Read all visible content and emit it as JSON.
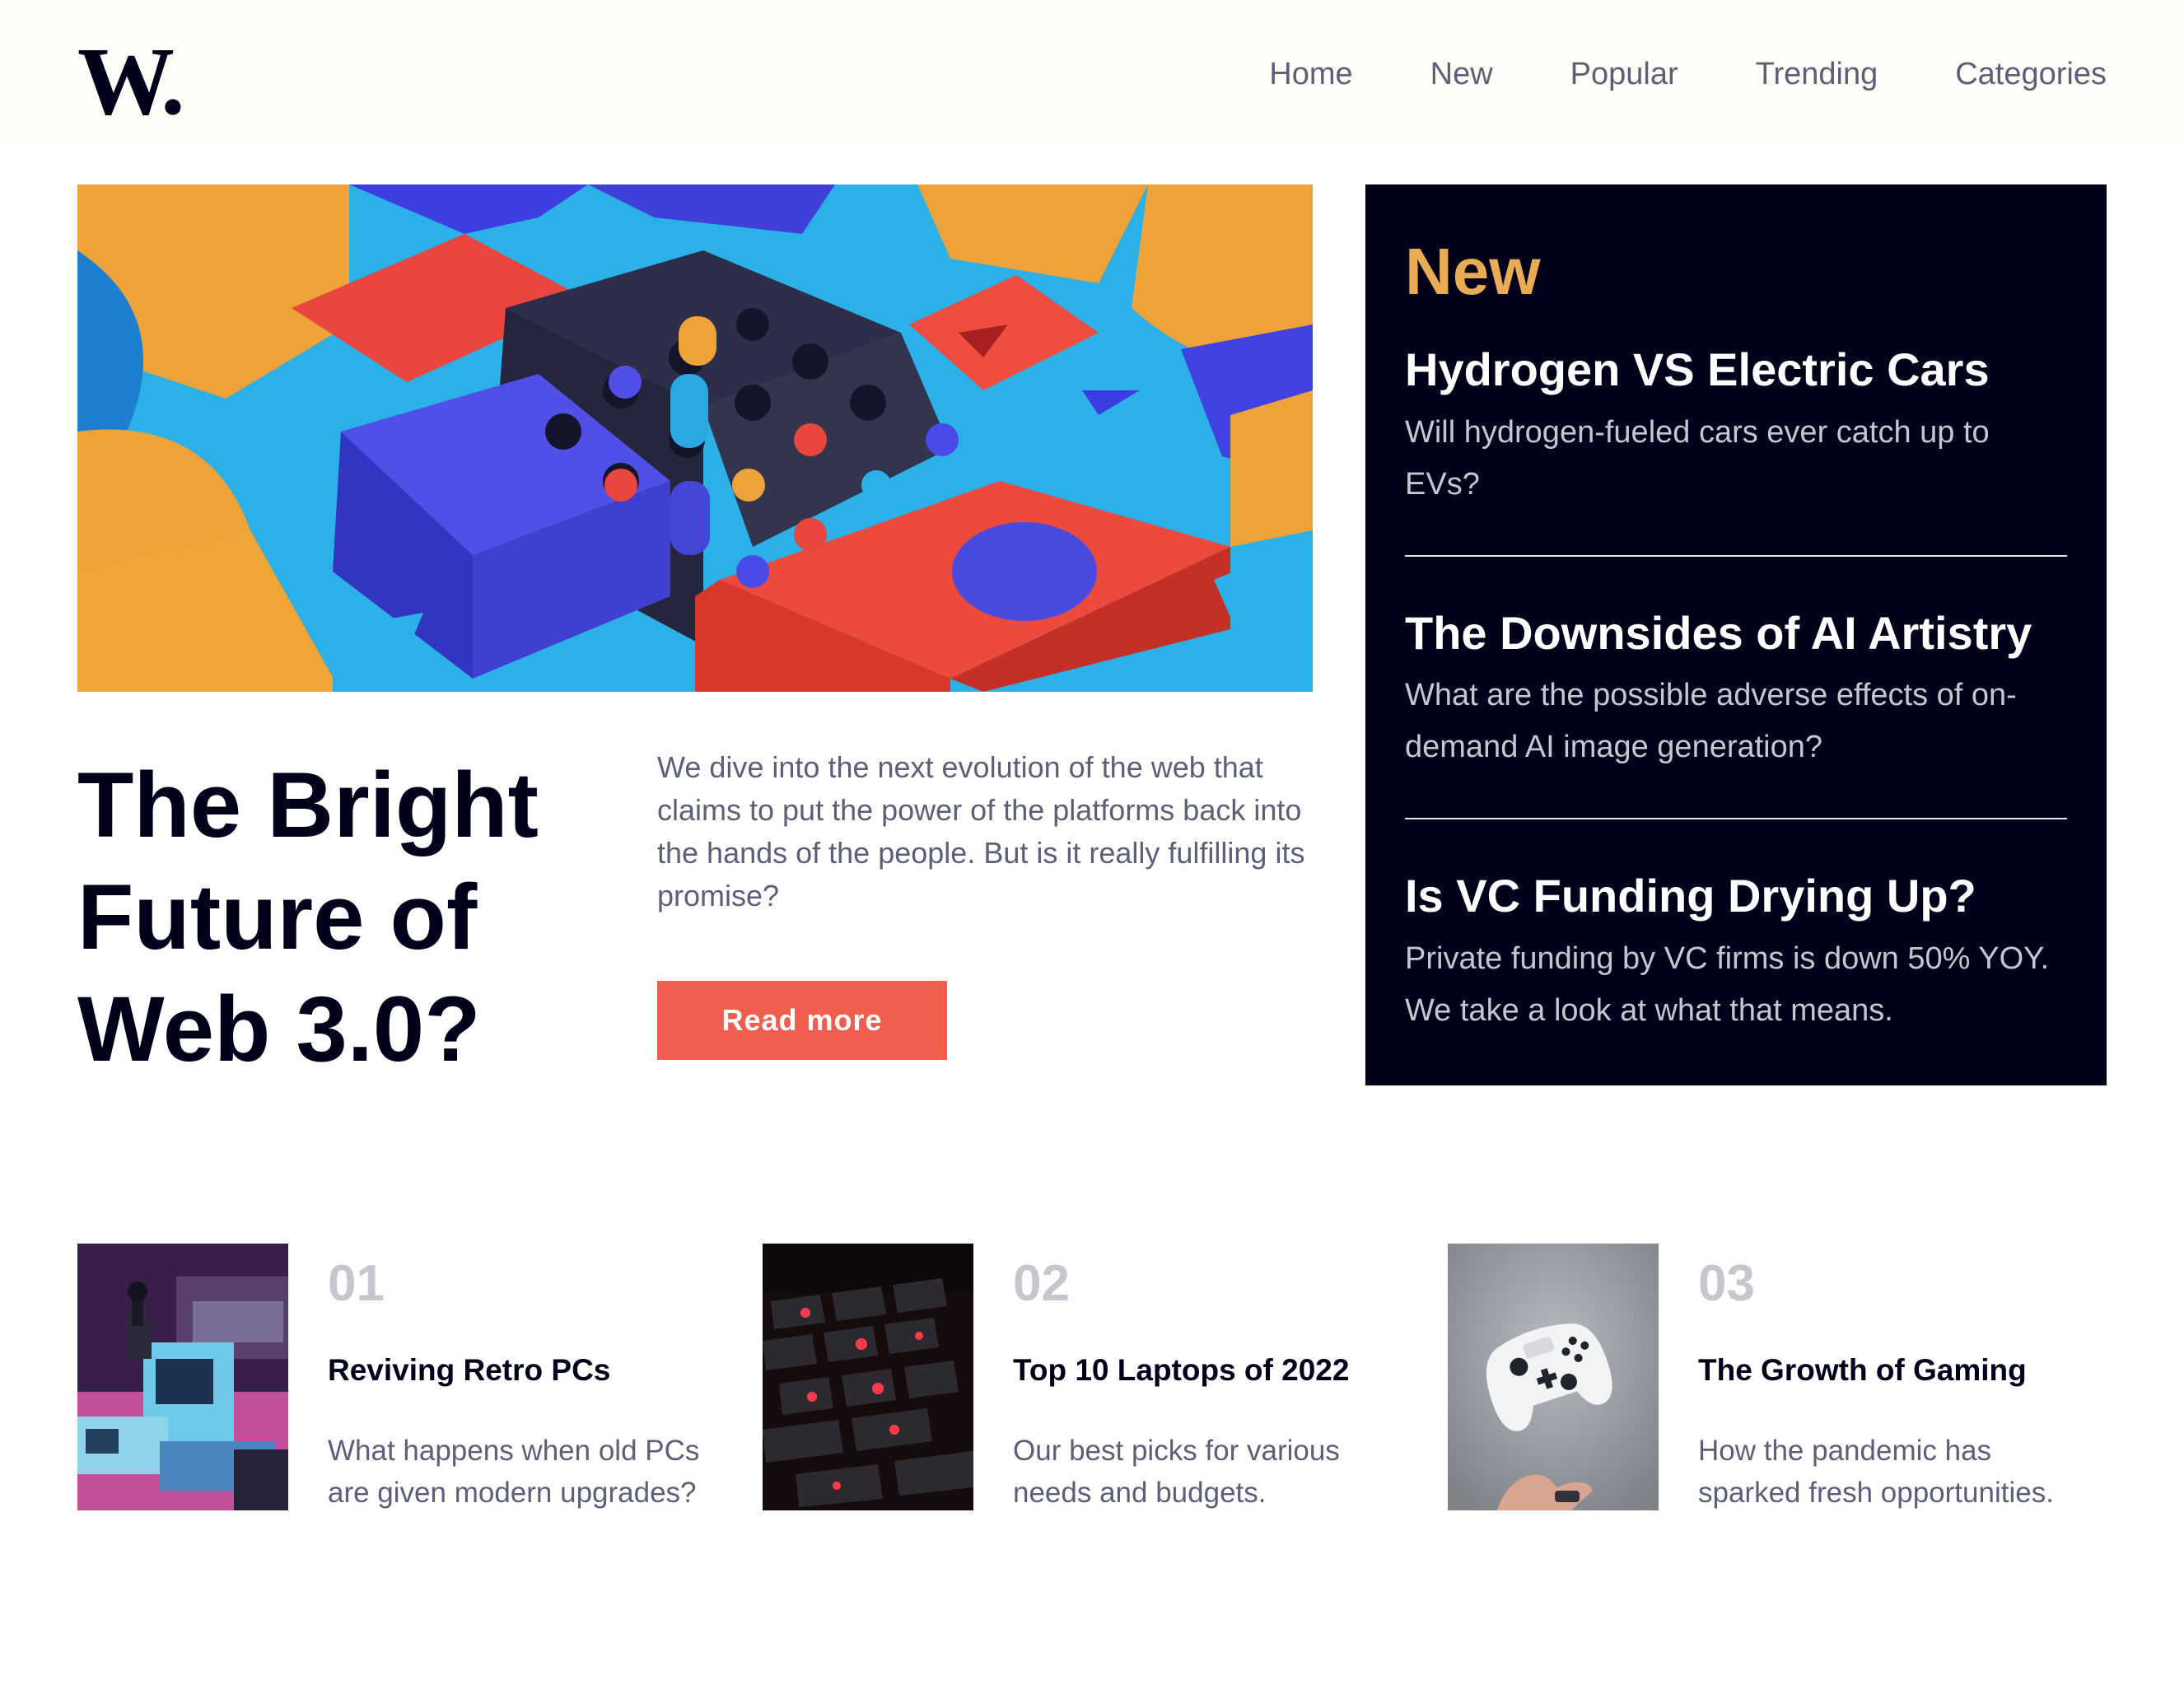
{
  "header": {
    "logo_text": "W.",
    "nav": [
      "Home",
      "New",
      "Popular",
      "Trending",
      "Categories"
    ]
  },
  "hero": {
    "image_icon": "colorful-3d-blocks-image",
    "title": "The Bright Future of Web 3.0?",
    "description": "We dive into the next evolution of the web that claims to put the power of the platforms back into the hands of the people. But is it really fulfilling its promise?",
    "button_label": "Read more"
  },
  "new_panel": {
    "heading": "New",
    "items": [
      {
        "title": "Hydrogen VS Electric Cars",
        "description": "Will hydrogen-fueled cars ever catch up to EVs?"
      },
      {
        "title": "The Downsides of AI Artistry",
        "description": "What are the possible adverse effects of on-demand AI image generation?"
      },
      {
        "title": "Is VC Funding Drying Up?",
        "description": "Private funding by VC firms is down 50% YOY. We take a look at what that means."
      }
    ]
  },
  "cards": [
    {
      "number": "01",
      "title": "Reviving Retro PCs",
      "description": "What happens when old PCs are given modern upgrades?",
      "image_icon": "retro-pc-image"
    },
    {
      "number": "02",
      "title": "Top 10 Laptops of 2022",
      "description": "Our best picks for various needs and budgets.",
      "image_icon": "laptop-keyboard-image"
    },
    {
      "number": "03",
      "title": "The Growth of Gaming",
      "description": "How the pandemic has sparked fresh opportunities.",
      "image_icon": "game-controller-image"
    }
  ],
  "colors": {
    "dark_navy": "#00001a",
    "accent_red": "#f15e50",
    "accent_orange": "#e9ab53",
    "grayish_blue": "#5d5f79",
    "light_gray": "#c5c6ce",
    "off_white": "#fffdf8"
  }
}
